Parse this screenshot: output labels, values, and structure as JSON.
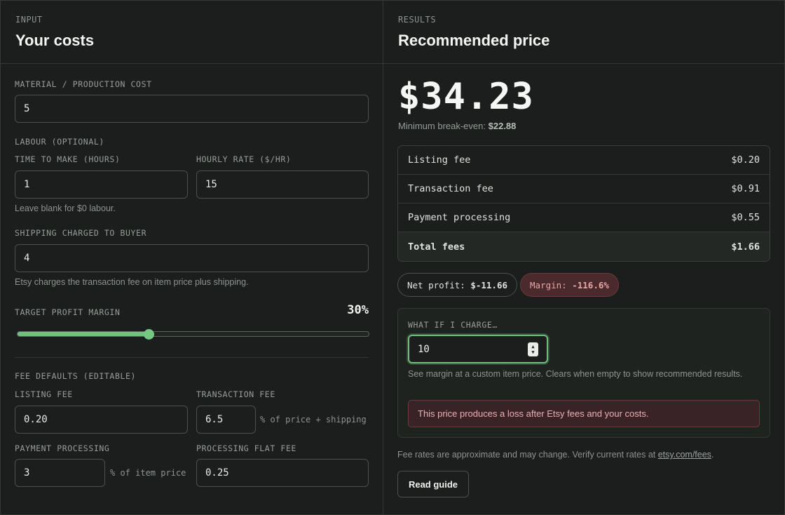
{
  "input": {
    "kicker": "INPUT",
    "title": "Your costs",
    "material_label": "MATERIAL / PRODUCTION COST",
    "material_value": "5",
    "labour_label": "LABOUR (OPTIONAL)",
    "time_label": "TIME TO MAKE (HOURS)",
    "time_value": "1",
    "rate_label": "HOURLY RATE ($/HR)",
    "rate_value": "15",
    "labour_hint": "Leave blank for $0 labour.",
    "shipping_label": "SHIPPING CHARGED TO BUYER",
    "shipping_value": "4",
    "shipping_hint": "Etsy charges the transaction fee on item price plus shipping.",
    "margin_label": "TARGET PROFIT MARGIN",
    "margin_value": "30%",
    "margin_fraction": 0.3,
    "fee_defaults_label": "FEE DEFAULTS (EDITABLE)",
    "listing_fee_label": "LISTING FEE",
    "listing_fee_value": "0.20",
    "transaction_fee_label": "TRANSACTION FEE",
    "transaction_fee_value": "6.5",
    "transaction_fee_suffix": "% of price + shipping",
    "payment_label": "PAYMENT PROCESSING",
    "payment_value": "3",
    "payment_suffix": "% of item price",
    "flat_fee_label": "PROCESSING FLAT FEE",
    "flat_fee_value": "0.25"
  },
  "results": {
    "kicker": "RESULTS",
    "title": "Recommended price",
    "price": "$34.23",
    "breakeven_label": "Minimum break-even:",
    "breakeven_value": "$22.88",
    "fees": [
      {
        "label": "Listing fee",
        "value": "$0.20"
      },
      {
        "label": "Transaction fee",
        "value": "$0.91"
      },
      {
        "label": "Payment processing",
        "value": "$0.55"
      },
      {
        "label": "Total fees",
        "value": "$1.66"
      }
    ],
    "net_profit_label": "Net profit:",
    "net_profit_value": "$-11.66",
    "margin_label": "Margin:",
    "margin_value": "-116.6%",
    "whatif_label": "WHAT IF I CHARGE…",
    "whatif_value": "10",
    "whatif_hint": "See margin at a custom item price. Clears when empty to show recommended results.",
    "alert": "This price produces a loss after Etsy fees and your costs.",
    "note_text": "Fee rates are approximate and may change. Verify current rates at",
    "note_link": "etsy.com/fees",
    "note_end": ".",
    "guide_button": "Read guide"
  },
  "colors": {
    "accent": "#6fc17c",
    "danger_bg": "#3a2327",
    "danger_text": "#e6b0b2"
  }
}
